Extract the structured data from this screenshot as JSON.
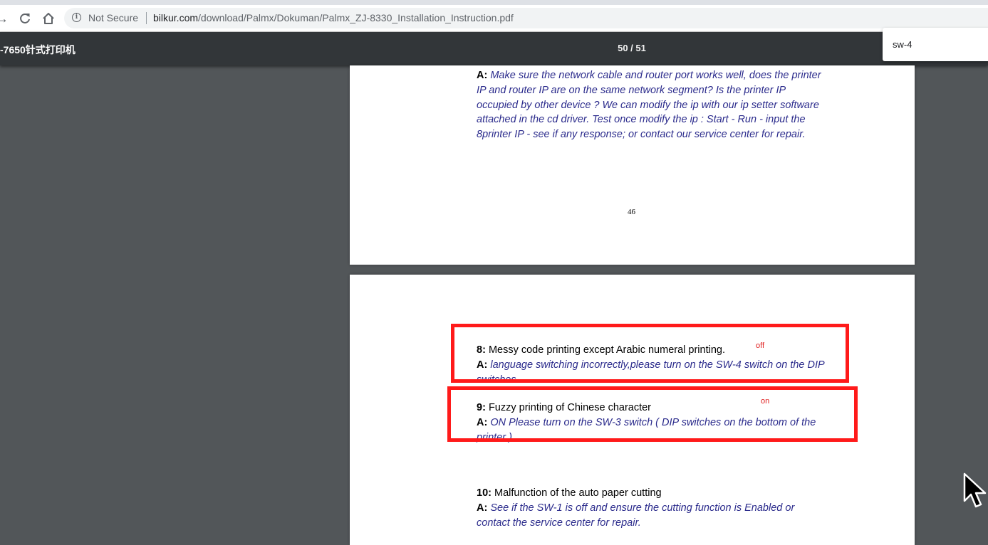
{
  "browser": {
    "security_label": "Not Secure",
    "url_host": "bilkur.com",
    "url_path": "/download/Palmx/Dokuman/Palmx_ZJ-8330_Installation_Instruction.pdf",
    "icons": [
      "forward-icon",
      "reload-icon",
      "home-icon",
      "info-icon"
    ]
  },
  "pdf_viewer": {
    "title": "-7650针式打印机",
    "page_indicator": "50 / 51"
  },
  "find_bar": {
    "query": "sw-4"
  },
  "page1": {
    "answer_label": "A:",
    "answer_lines": [
      "Make sure the network cable and router port works well, does the printer",
      "IP and router IP are on the same network segment? Is the printer IP",
      "occupied by other device ? We can modify the ip with our ip setter software",
      "attached in the cd driver. Test once modify the ip : Start - Run - input the",
      "8printer IP - see if any response; or contact our service center for repair."
    ],
    "page_number": "46"
  },
  "page2": {
    "q8": {
      "label": "8:",
      "question": "Messy code printing except Arabic numeral printing.",
      "answer_label": "A:",
      "answer_line1": "language switching incorrectly,please turn on the SW-4 switch on the DIP",
      "answer_line2": "switches"
    },
    "q9": {
      "label": "9:",
      "question": "Fuzzy printing of Chinese character",
      "answer_label": "A:",
      "answer_line1": "ON Please turn on the SW-3 switch ( DIP switches on the bottom of the",
      "answer_line2": "printer )"
    },
    "q10": {
      "label": "10:",
      "question": "Malfunction of the auto paper cutting",
      "answer_label": "A:",
      "answer_line1": "See if the SW-1 is off and ensure the cutting function is Enabled or",
      "answer_line2": "contact the service center for repair."
    }
  },
  "annotations": {
    "color": "#ff1a1a",
    "note_off": "off",
    "note_on": "on"
  }
}
